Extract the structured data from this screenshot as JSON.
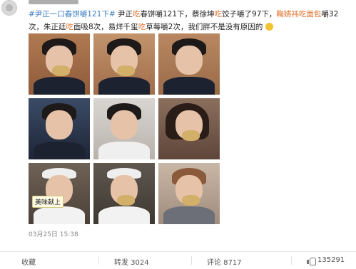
{
  "post": {
    "text": {
      "topic": "#尹正一口春饼嚼121下#",
      "seg1": "尹正",
      "seg2": "吃",
      "seg3": "春饼嚼121下，蔡徐坤",
      "seg4": "吃",
      "seg5": "饺子嚼了97下，",
      "seg6": "鞠婧祎吃面包",
      "seg7": "嚼32次，朱正廷",
      "seg8": "吃",
      "seg9": "面吸8次，易烊千玺",
      "seg10": "吃",
      "seg11": "草莓嚼2次，我们胖不是没有原因的"
    },
    "photos": [
      {
        "tag": ""
      },
      {
        "tag": ""
      },
      {
        "tag": ""
      },
      {
        "tag": ""
      },
      {
        "tag": ""
      },
      {
        "tag": ""
      },
      {
        "tag": "美味献上"
      },
      {
        "tag": ""
      },
      {
        "tag": ""
      }
    ],
    "timestamp": "03月25日 15:38"
  },
  "actions": {
    "collect_label": "收藏",
    "repost_label": "转发 3024",
    "comment_label": "评论 8717",
    "like_count": "135291"
  },
  "colors": {
    "topic": "#3a7ec2",
    "highlight": "#e0702a"
  }
}
